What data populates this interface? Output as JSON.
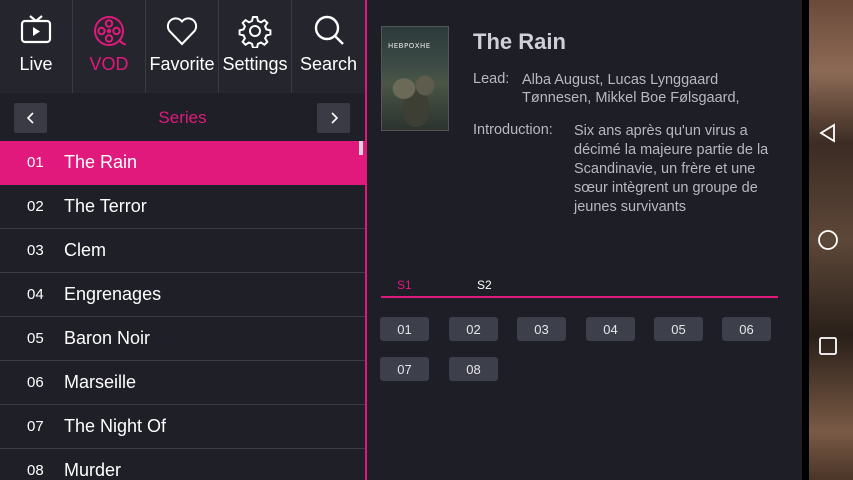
{
  "nav": [
    {
      "label": "Live",
      "icon": "tv-icon",
      "active": false
    },
    {
      "label": "VOD",
      "icon": "film-reel-icon",
      "active": true
    },
    {
      "label": "Favorite",
      "icon": "heart-icon",
      "active": false
    },
    {
      "label": "Settings",
      "icon": "gear-icon",
      "active": false
    },
    {
      "label": "Search",
      "icon": "search-icon",
      "active": false
    }
  ],
  "category": {
    "title": "Series"
  },
  "series_list": [
    {
      "num": "01",
      "title": "The Rain"
    },
    {
      "num": "02",
      "title": "The Terror"
    },
    {
      "num": "03",
      "title": "Clem"
    },
    {
      "num": "04",
      "title": "Engrenages"
    },
    {
      "num": "05",
      "title": "Baron Noir"
    },
    {
      "num": "06",
      "title": "Marseille"
    },
    {
      "num": "07",
      "title": "The Night Of"
    },
    {
      "num": "08",
      "title": "Murder"
    }
  ],
  "selected_index": 0,
  "detail": {
    "title": "The Rain",
    "lead_label": "Lead:",
    "lead_text": "Alba August, Lucas Lynggaard Tønnesen, Mikkel Boe Følsgaard,",
    "intro_label": "Introduction:",
    "intro_text": "Six ans après qu'un virus a décimé la majeure partie de la Scandinavie, un frère et une sœur intègrent un groupe de jeunes survivants",
    "poster_text": "НЕВРОХНЕ"
  },
  "seasons": [
    {
      "label": "S1",
      "active": true
    },
    {
      "label": "S2",
      "active": false
    }
  ],
  "episodes": [
    "01",
    "02",
    "03",
    "04",
    "05",
    "06",
    "07",
    "08"
  ],
  "colors": {
    "accent": "#e1197c",
    "background": "#1e1e26",
    "episode_button": "#3d3f4a"
  },
  "system_nav": [
    {
      "icon": "back-triangle-icon"
    },
    {
      "icon": "home-circle-icon"
    },
    {
      "icon": "recents-square-icon"
    }
  ]
}
